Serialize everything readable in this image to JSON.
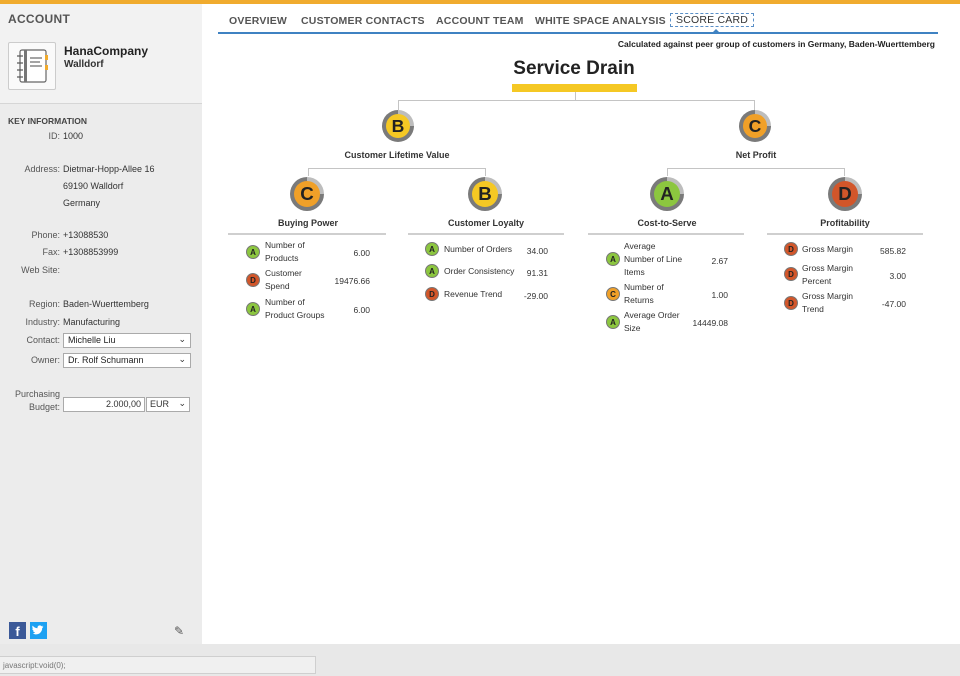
{
  "sidebar": {
    "title": "ACCOUNT",
    "company_name": "HanaCompany",
    "company_city": "Walldorf",
    "key_info_title": "KEY INFORMATION",
    "id_label": "ID:",
    "id_value": "1000",
    "address_label": "Address:",
    "address_line1": "Dietmar-Hopp-Allee 16",
    "address_line2": "69190 Walldorf",
    "address_line3": "Germany",
    "phone_label": "Phone:",
    "phone_value": "+13088530",
    "fax_label": "Fax:",
    "fax_value": "+1308853999",
    "website_label": "Web Site:",
    "region_label": "Region:",
    "region_value": "Baden-Wuerttemberg",
    "industry_label": "Industry:",
    "industry_value": "Manufacturing",
    "contact_label": "Contact:",
    "contact_value": "Michelle Liu",
    "owner_label": "Owner:",
    "owner_value": "Dr. Rolf Schumann",
    "budget_label1": "Purchasing",
    "budget_label2": "Budget:",
    "budget_value": "2.000,00",
    "currency_value": "EUR",
    "facebook_glyph": "f"
  },
  "tabs": {
    "overview": "OVERVIEW",
    "contacts": "CUSTOMER CONTACTS",
    "team": "ACCOUNT TEAM",
    "whitespace": "WHITE SPACE ANALYSIS",
    "scorecard": "SCORE CARD"
  },
  "scorecard": {
    "note": "Calculated against peer group of customers in Germany, Baden-Wuerttemberg",
    "title": "Service Drain",
    "clv": {
      "grade": "B",
      "label": "Customer Lifetime Value"
    },
    "net_profit": {
      "grade": "C",
      "label": "Net Profit"
    },
    "buying_power": {
      "grade": "C",
      "label": "Buying Power",
      "metrics": [
        {
          "grade": "A",
          "label1": "Number of",
          "label2": "Products",
          "value": "6.00"
        },
        {
          "grade": "D",
          "label1": "Customer",
          "label2": "Spend",
          "value": "19476.66"
        },
        {
          "grade": "A",
          "label1": "Number of",
          "label2": "Product Groups",
          "value": "6.00"
        }
      ]
    },
    "loyalty": {
      "grade": "B",
      "label": "Customer Loyalty",
      "metrics": [
        {
          "grade": "A",
          "label1": "Number of Orders",
          "value": "34.00"
        },
        {
          "grade": "A",
          "label1": "Order Consistency",
          "value": "91.31"
        },
        {
          "grade": "D",
          "label1": "Revenue Trend",
          "value": "-29.00"
        }
      ]
    },
    "cost_to_serve": {
      "grade": "A",
      "label": "Cost-to-Serve",
      "metrics": [
        {
          "grade": "A",
          "label1": "Average",
          "label2": "Number of Line",
          "label3": "Items",
          "value": "2.67"
        },
        {
          "grade": "C",
          "label1": "Number of",
          "label2": "Returns",
          "value": "1.00"
        },
        {
          "grade": "A",
          "label1": "Average Order",
          "label2": "Size",
          "value": "14449.08"
        }
      ]
    },
    "profitability": {
      "grade": "D",
      "label": "Profitability",
      "metrics": [
        {
          "grade": "D",
          "label1": "Gross Margin",
          "value": "585.82"
        },
        {
          "grade": "D",
          "label1": "Gross Margin",
          "label2": "Percent",
          "value": "3.00"
        },
        {
          "grade": "D",
          "label1": "Gross Margin",
          "label2": "Trend",
          "value": "-47.00"
        }
      ]
    },
    "grade_colors": {
      "A": "#8cc63f",
      "B": "#f5c824",
      "C": "#f0a028",
      "D": "#d2562a"
    }
  },
  "status": {
    "text": "javascript:void(0);"
  }
}
